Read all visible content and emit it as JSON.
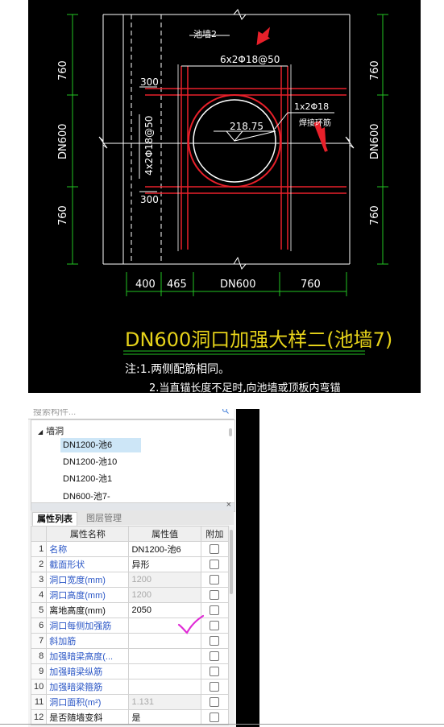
{
  "drawing": {
    "label_wall": "池墙2",
    "label_top_bars": "6x2Φ18@50",
    "label_300_top": "300",
    "label_300_bottom": "300",
    "label_side_bars": "4x2Φ18@50",
    "label_ring": "1x2Φ18",
    "label_ring_note": "焊接环筋",
    "label_radius": "218.75",
    "dim_left_top": "760",
    "dim_left_mid": "DN600",
    "dim_left_bottom": "760",
    "dim_right_top": "760",
    "dim_right_mid": "DN600",
    "dim_right_bottom": "760",
    "dim_bottom_1": "400",
    "dim_bottom_2": "465",
    "dim_bottom_3": "DN600",
    "dim_bottom_4": "760",
    "title": "DN600洞口加强大样二(池墙7)",
    "note_1": "注:1.两侧配筋相同。",
    "note_2": "2.当直锚长度不足时,向池墙或顶板内弯锚",
    "colors": {
      "line": "#ffffff",
      "rebar": "#e8202a",
      "dim": "#22c322",
      "title": "#e6d21a",
      "arrow": "#e8202a"
    }
  },
  "panel": {
    "search_placeholder": "搜索构件...",
    "tree": {
      "root": "墙洞",
      "items": [
        {
          "label": "DN1200-池6",
          "selected": true
        },
        {
          "label": "DN1200-池10",
          "selected": false
        },
        {
          "label": "DN1200-池1",
          "selected": false
        },
        {
          "label": "DN600-池7-",
          "selected": false
        }
      ]
    },
    "tabs": [
      {
        "label": "属性列表",
        "active": true
      },
      {
        "label": "图层管理",
        "active": false
      }
    ],
    "table": {
      "headers": {
        "name": "属性名称",
        "value": "属性值",
        "extra": "附加"
      },
      "rows": [
        {
          "num": "1",
          "name": "名称",
          "value": "DN1200-池6",
          "name_color": "blue",
          "value_gray": false
        },
        {
          "num": "2",
          "name": "截面形状",
          "value": "异形",
          "name_color": "blue",
          "value_gray": false
        },
        {
          "num": "3",
          "name": "洞口宽度(mm)",
          "value": "1200",
          "name_color": "blue",
          "value_gray": true
        },
        {
          "num": "4",
          "name": "洞口高度(mm)",
          "value": "1200",
          "name_color": "blue",
          "value_gray": true
        },
        {
          "num": "5",
          "name": "离地高度(mm)",
          "value": "2050",
          "name_color": "black",
          "value_gray": false
        },
        {
          "num": "6",
          "name": "洞口每侧加强筋",
          "value": "",
          "name_color": "blue",
          "value_gray": false
        },
        {
          "num": "7",
          "name": "斜加筋",
          "value": "",
          "name_color": "blue",
          "value_gray": false
        },
        {
          "num": "8",
          "name": "加强暗梁高度(...",
          "value": "",
          "name_color": "blue",
          "value_gray": false
        },
        {
          "num": "9",
          "name": "加强暗梁纵筋",
          "value": "",
          "name_color": "blue",
          "value_gray": false
        },
        {
          "num": "10",
          "name": "加强暗梁箍筋",
          "value": "",
          "name_color": "blue",
          "value_gray": false
        },
        {
          "num": "11",
          "name": "洞口面积(m²)",
          "value": "1.131",
          "name_color": "blue",
          "value_gray": true
        },
        {
          "num": "12",
          "name": "是否随墙变斜",
          "value": "是",
          "name_color": "black",
          "value_gray": false
        }
      ]
    }
  },
  "annotation_check_color": "#e02bd6"
}
